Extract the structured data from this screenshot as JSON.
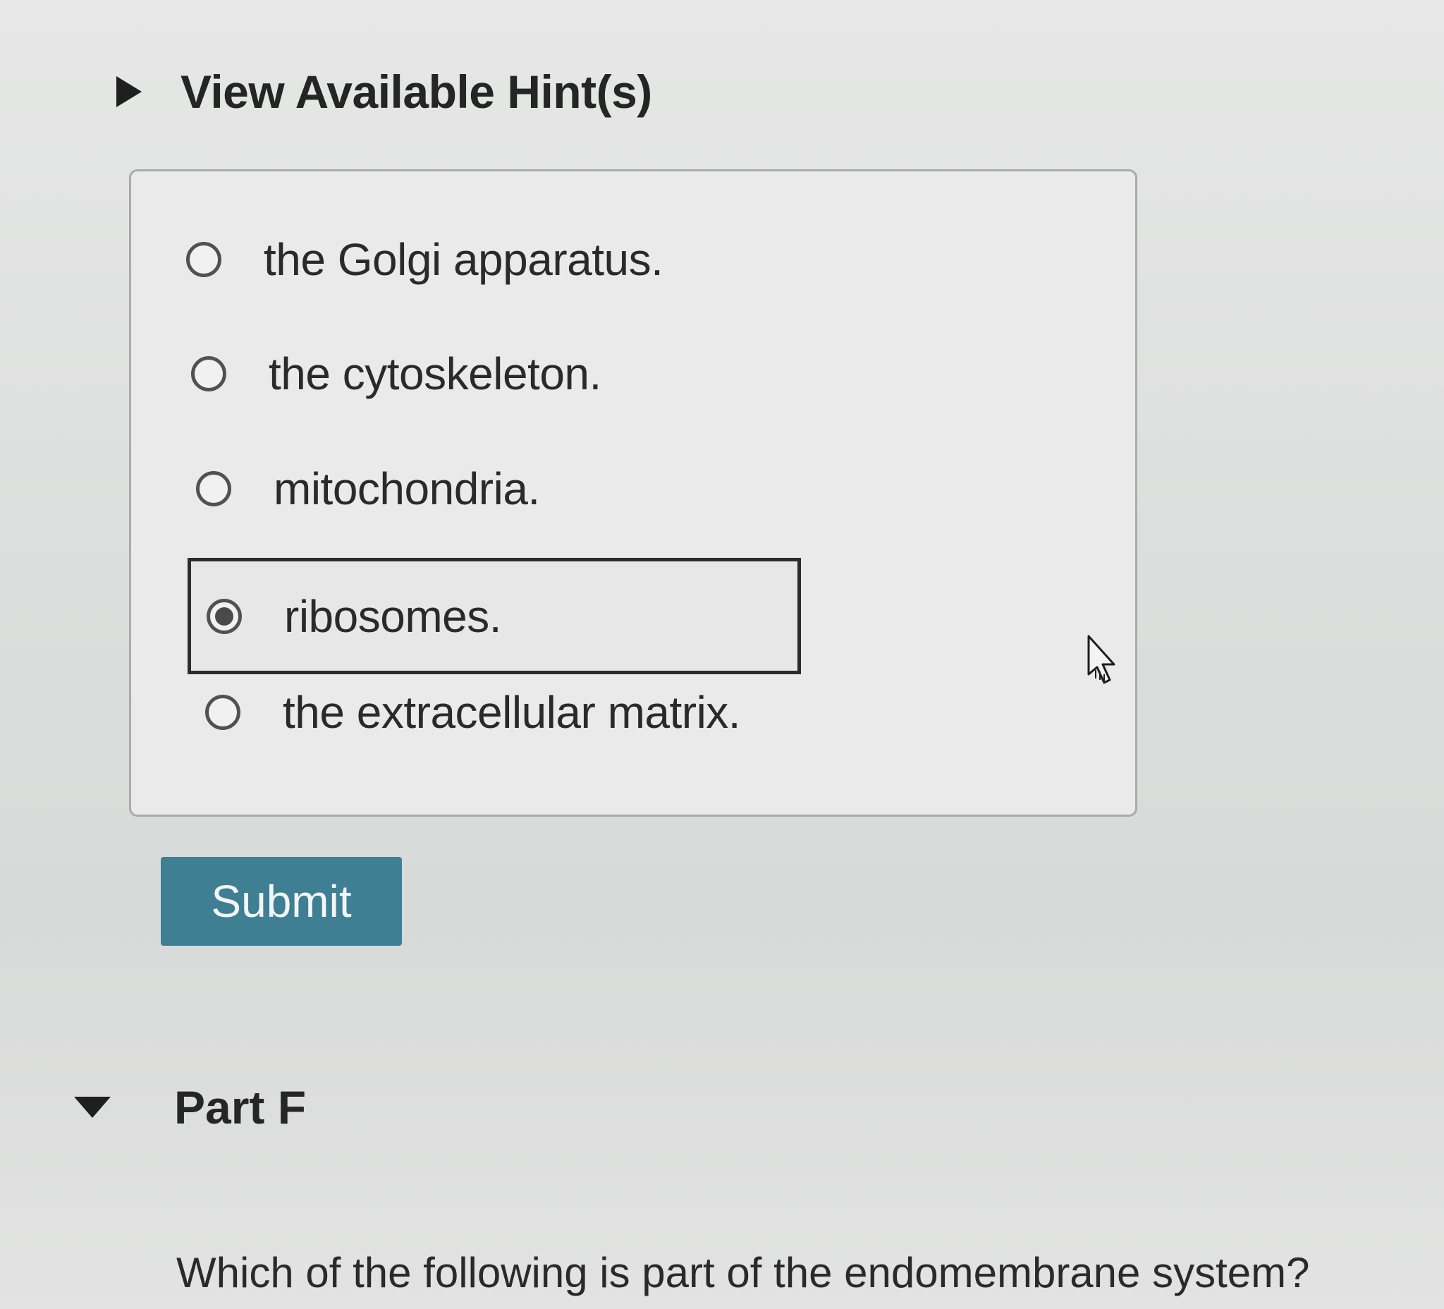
{
  "hints": {
    "label": "View Available Hint(s)"
  },
  "choices": [
    {
      "label": "the Golgi apparatus.",
      "selected": false
    },
    {
      "label": "the cytoskeleton.",
      "selected": false
    },
    {
      "label": "mitochondria.",
      "selected": false
    },
    {
      "label": "ribosomes.",
      "selected": true
    },
    {
      "label": "the extracellular matrix.",
      "selected": false
    }
  ],
  "submit": {
    "label": "Submit"
  },
  "part_f": {
    "title": "Part F",
    "question": "Which of the following is part of the endomembrane system?"
  },
  "colors": {
    "submit_bg": "#3f7f93",
    "background": "#dedfde"
  },
  "icons": {
    "hints_toggle": "caret-right-icon",
    "part_toggle": "caret-down-icon",
    "pointer": "hand-cursor-icon"
  }
}
